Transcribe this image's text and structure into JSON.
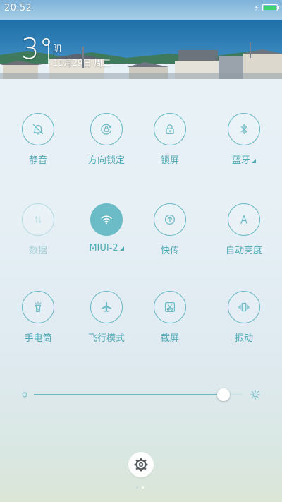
{
  "status_bar": {
    "time": "20:52",
    "battery_percent": 100
  },
  "weather": {
    "temperature": "3°",
    "condition": "阴",
    "date": "11月29日 周二"
  },
  "toggles": [
    {
      "label": "静音",
      "icon": "bell-mute-icon",
      "state": "off"
    },
    {
      "label": "方向锁定",
      "icon": "rotation-lock-icon",
      "state": "off"
    },
    {
      "label": "锁屏",
      "icon": "lock-icon",
      "state": "off"
    },
    {
      "label": "蓝牙",
      "icon": "bluetooth-icon",
      "state": "off",
      "has_more": true
    },
    {
      "label": "数据",
      "icon": "mobile-data-icon",
      "state": "disabled"
    },
    {
      "label": "MIUI-2",
      "icon": "wifi-icon",
      "state": "on",
      "has_more": true
    },
    {
      "label": "快传",
      "icon": "quick-transfer-icon",
      "state": "off"
    },
    {
      "label": "自动亮度",
      "icon": "auto-brightness-icon",
      "state": "off"
    },
    {
      "label": "手电筒",
      "icon": "flashlight-icon",
      "state": "off"
    },
    {
      "label": "飞行模式",
      "icon": "airplane-icon",
      "state": "off"
    },
    {
      "label": "截屏",
      "icon": "screenshot-icon",
      "state": "off"
    },
    {
      "label": "振动",
      "icon": "vibrate-icon",
      "state": "off"
    }
  ],
  "brightness": {
    "level": 0.91
  },
  "pager": {
    "current": 2,
    "total": 2
  },
  "colors": {
    "accent": "#6bbcc7",
    "label": "#4fa9b5",
    "disabled": "#a8d0d8"
  }
}
